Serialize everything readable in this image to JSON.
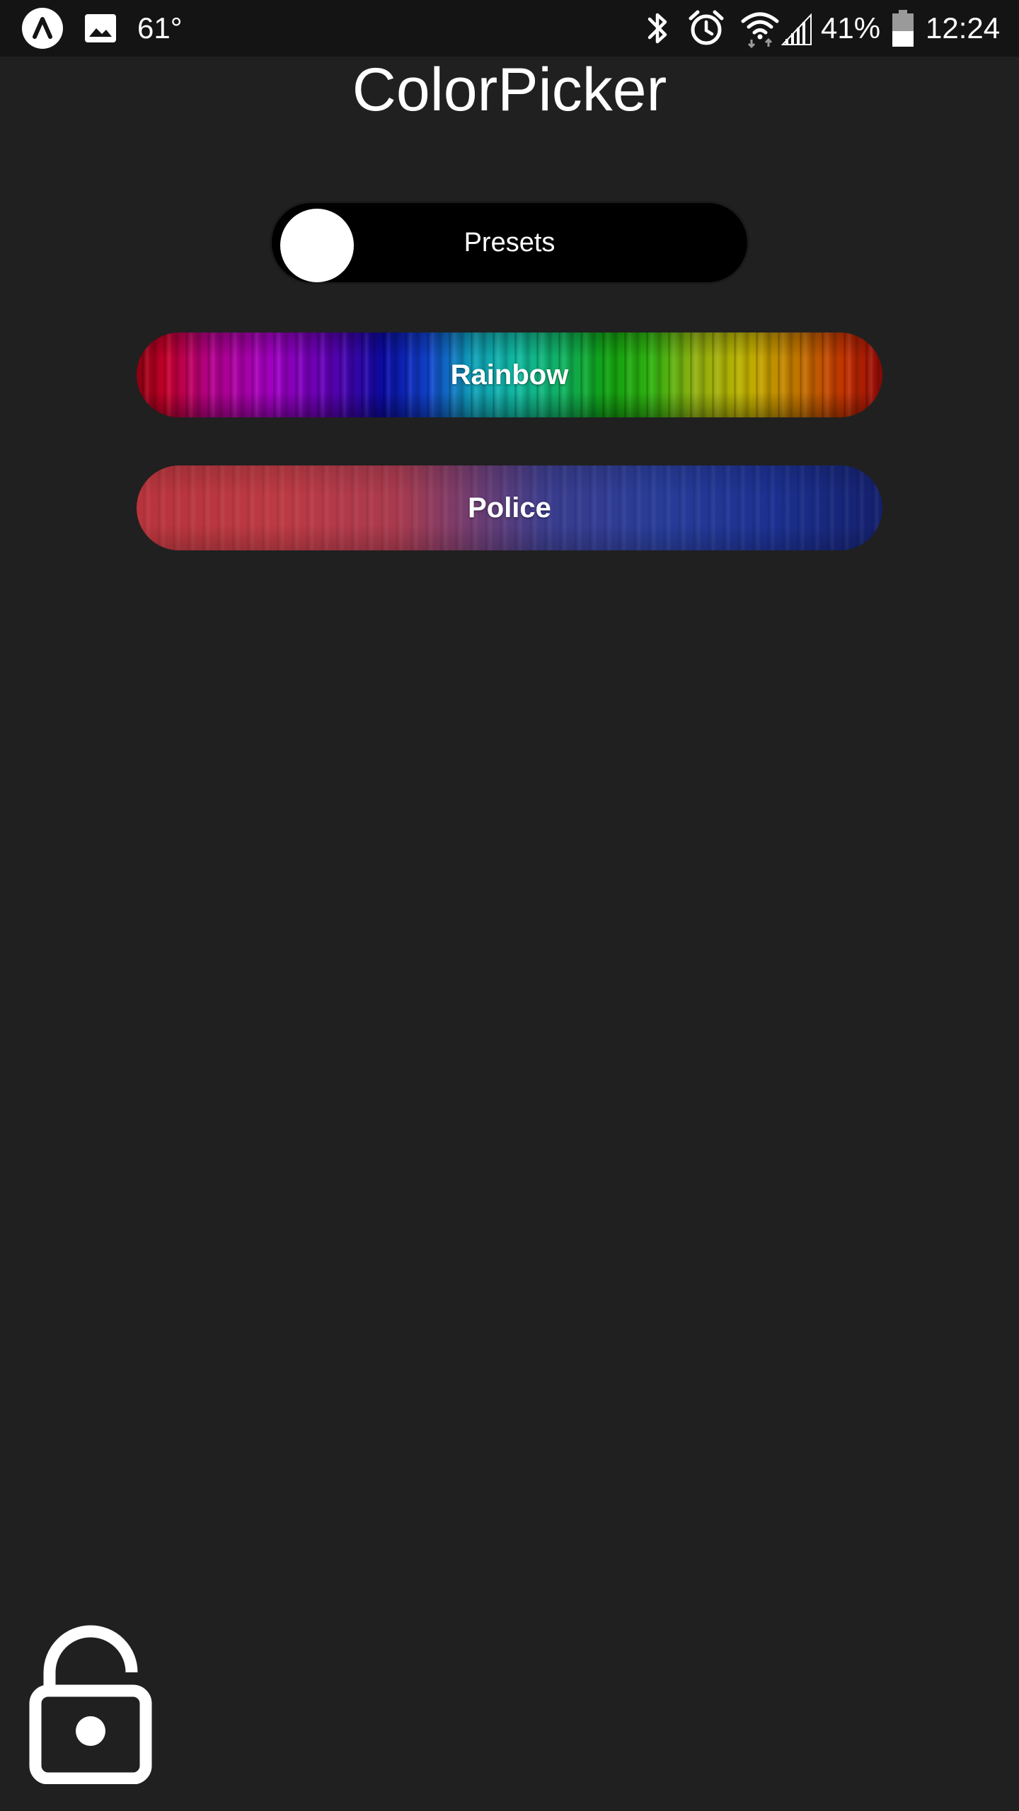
{
  "status_bar": {
    "temperature": "61°",
    "battery_percent": "41%",
    "time": "12:24",
    "icons": [
      "app-logo-icon",
      "image-icon",
      "bluetooth-icon",
      "alarm-icon",
      "wifi-icon",
      "cell-signal-icon",
      "battery-icon"
    ]
  },
  "app": {
    "title": "ColorPicker"
  },
  "presets_toggle": {
    "label": "Presets",
    "state": "off"
  },
  "presets": [
    {
      "label": "Rainbow"
    },
    {
      "label": "Police"
    }
  ],
  "lock": {
    "icon": "unlocked-padlock-icon",
    "state": "unlocked"
  },
  "colors": {
    "background": "#202020",
    "status_bar": "#141414",
    "toggle_track": "#000000",
    "toggle_knob": "#ffffff",
    "police_red": "#b8343c",
    "police_blue": "#1c3090"
  }
}
